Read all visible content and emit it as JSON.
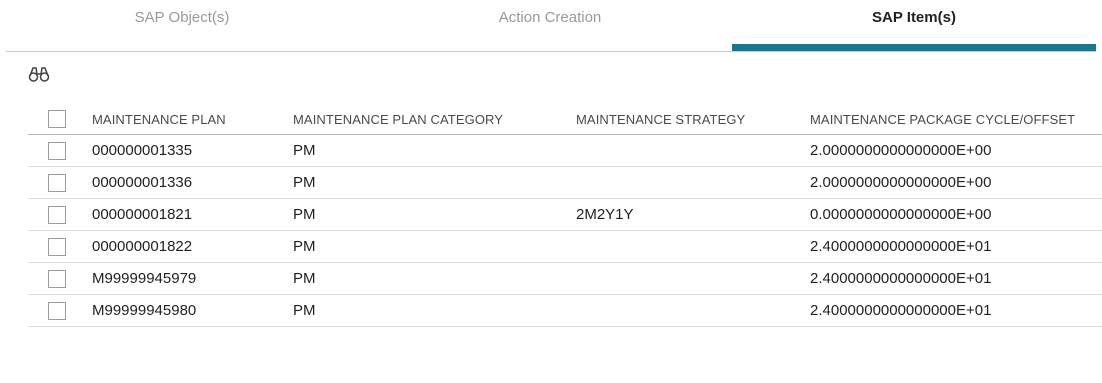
{
  "tabs": [
    {
      "label": "SAP Object(s)",
      "active": false
    },
    {
      "label": "Action Creation",
      "active": false
    },
    {
      "label": "SAP Item(s)",
      "active": true
    }
  ],
  "toolbar": {
    "find_icon": "binoculars-icon"
  },
  "table": {
    "columns": [
      "MAINTENANCE PLAN",
      "MAINTENANCE PLAN CATEGORY",
      "MAINTENANCE STRATEGY",
      "MAINTENANCE PACKAGE CYCLE/OFFSET"
    ],
    "rows": [
      {
        "plan": "000000001335",
        "category": "PM",
        "strategy": "",
        "cycle": "2.0000000000000000E+00"
      },
      {
        "plan": "000000001336",
        "category": "PM",
        "strategy": "",
        "cycle": "2.0000000000000000E+00"
      },
      {
        "plan": "000000001821",
        "category": "PM",
        "strategy": "2M2Y1Y",
        "cycle": "0.0000000000000000E+00"
      },
      {
        "plan": "000000001822",
        "category": "PM",
        "strategy": "",
        "cycle": "2.4000000000000000E+01"
      },
      {
        "plan": "M99999945979",
        "category": "PM",
        "strategy": "",
        "cycle": "2.4000000000000000E+01"
      },
      {
        "plan": "M99999945980",
        "category": "PM",
        "strategy": "",
        "cycle": "2.4000000000000000E+01"
      }
    ]
  },
  "colors": {
    "accent": "#0f7a92",
    "inactive_tab_text": "#9a9a9a"
  }
}
